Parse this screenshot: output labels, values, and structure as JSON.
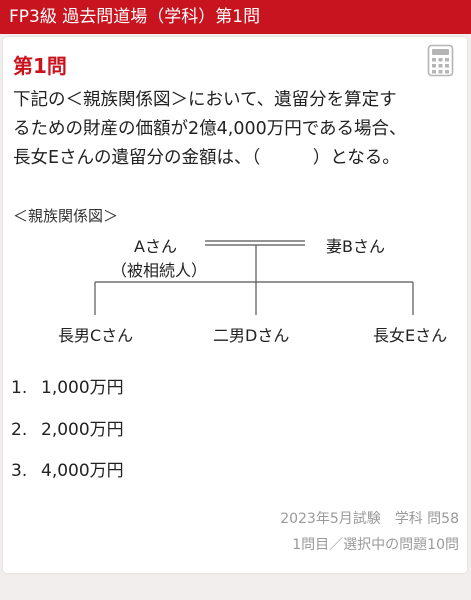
{
  "header": {
    "title": "FP3級 過去問道場（学科）第1問"
  },
  "question": {
    "title": "第1問",
    "lines": [
      "下記の＜親族関係図＞において、遺留分を算定す",
      "るための財産の価額が2億4,000万円である場合、",
      "長女Eさんの遺留分の金額は、（　　　）となる。"
    ]
  },
  "diagram": {
    "label": "＜親族関係図＞",
    "person_a": "Aさん",
    "person_a_note": "（被相続人）",
    "spouse": "妻Bさん",
    "child1": "長男Cさん",
    "child2": "二男Dさん",
    "child3": "長女Eさん"
  },
  "choices": [
    {
      "num": "1.",
      "text": "1,000万円"
    },
    {
      "num": "2.",
      "text": "2,000万円"
    },
    {
      "num": "3.",
      "text": "4,000万円"
    }
  ],
  "meta": {
    "source": "2023年5月試験　学科 問58",
    "position": "1問目／選択中の問題10問"
  },
  "icons": {
    "calculator": "calculator-icon"
  },
  "colors": {
    "accent": "#c8141e",
    "muted": "#9a9a9a"
  }
}
